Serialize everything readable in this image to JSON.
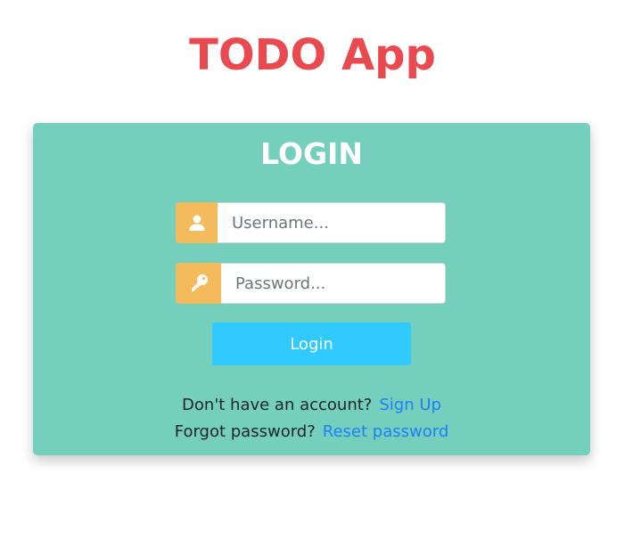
{
  "app": {
    "title": "TODO App",
    "title_color": "#e84a4f"
  },
  "login_card": {
    "title": "LOGIN",
    "background_color": "#74cfbd",
    "username": {
      "placeholder": "Username...",
      "value": "",
      "icon": "user-icon"
    },
    "password": {
      "placeholder": "Password...",
      "value": "",
      "icon": "key-icon"
    },
    "addon_color": "#f4bb5d",
    "login_button": {
      "label": "Login",
      "color": "#30caff"
    },
    "signup_prompt": {
      "text": "Don't have an account?",
      "link": "Sign Up"
    },
    "reset_prompt": {
      "text": "Forgot password?",
      "link": "Reset password"
    },
    "link_color": "#1f7ff5"
  }
}
